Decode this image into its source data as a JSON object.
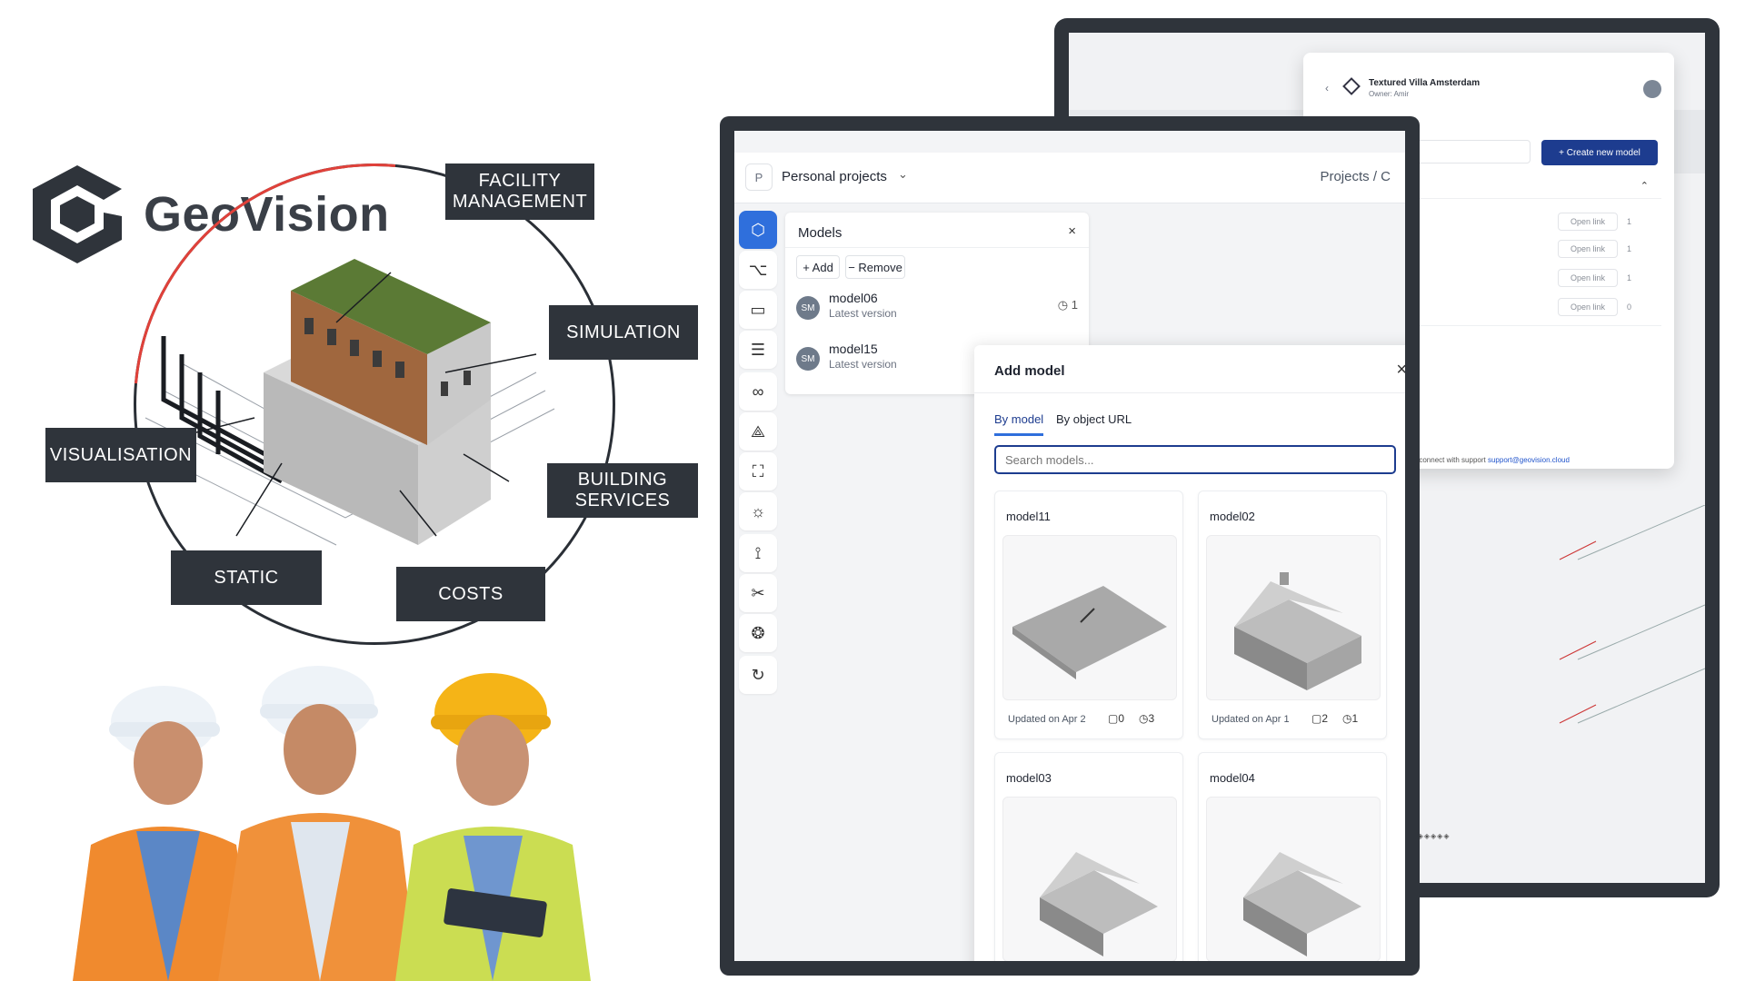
{
  "brand": {
    "name": "GeoVision"
  },
  "diagram": {
    "labels": {
      "facility": "FACILITY\nMANAGEMENT",
      "simulation": "SIMULATION",
      "visualisation": "VISUALISATION",
      "building_services": "BUILDING\nSERVICES",
      "static": "STATIC",
      "costs": "COSTS"
    }
  },
  "back_window": {
    "title": "Textured Villa Amsterdam",
    "owner": "Owner: Amir",
    "create_button": "+ Create new model",
    "open_link": "Open link",
    "comment_counts": [
      "1",
      "1",
      "1",
      "0"
    ],
    "help_text": "help connect with support",
    "help_email": "support@geovision.cloud"
  },
  "front_window": {
    "project_badge": "P",
    "project_name": "Personal projects",
    "breadcrumb": "Projects / C",
    "models_panel": {
      "title": "Models",
      "add_label": "+ Add",
      "remove_label": "− Remove",
      "rows": [
        {
          "avatar": "SM",
          "name": "model06",
          "sub": "Latest version",
          "versions": "1"
        },
        {
          "avatar": "SM",
          "name": "model15",
          "sub": "Latest version",
          "versions": ""
        }
      ]
    },
    "add_modal": {
      "title": "Add model",
      "tabs": [
        "By model",
        "By object URL"
      ],
      "search_placeholder": "Search models...",
      "cards": [
        {
          "name": "model11",
          "updated": "Updated on Apr 2",
          "comments": "0",
          "versions": "3"
        },
        {
          "name": "model02",
          "updated": "Updated on Apr 1",
          "comments": "2",
          "versions": "1"
        },
        {
          "name": "model03",
          "updated": "",
          "comments": "",
          "versions": ""
        },
        {
          "name": "model04",
          "updated": "",
          "comments": "",
          "versions": ""
        }
      ]
    }
  },
  "colors": {
    "accent": "#2f6fdc",
    "primary_dark": "#1d3c8f",
    "frame": "#2f343b"
  }
}
